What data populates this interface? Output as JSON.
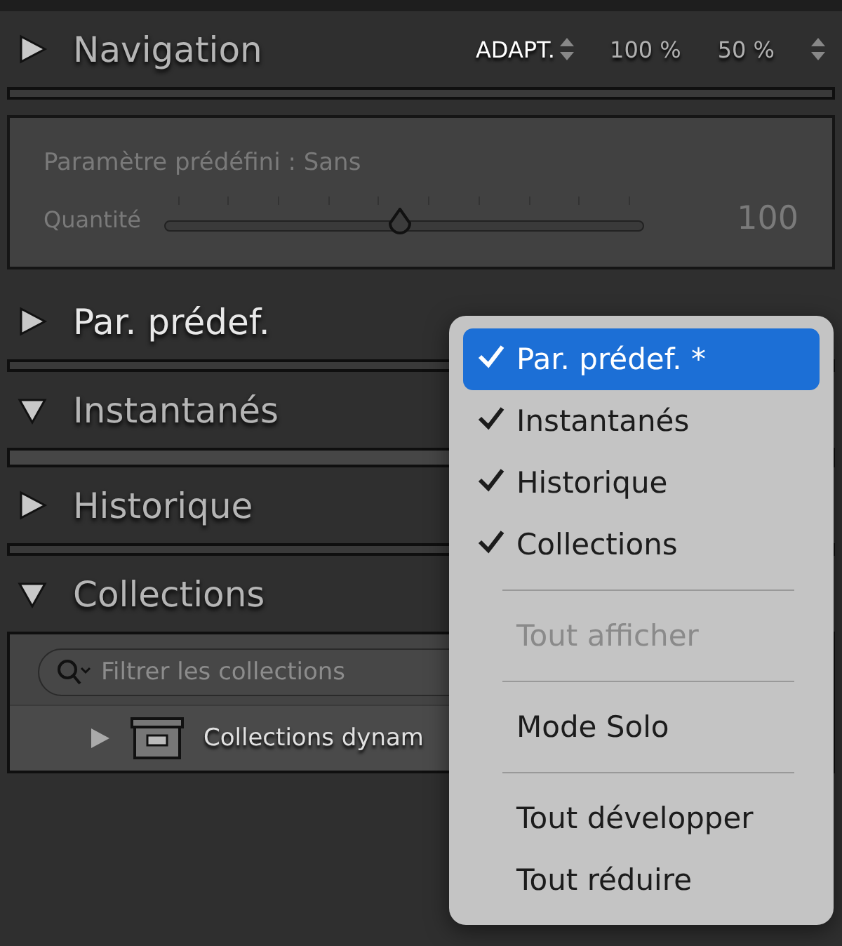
{
  "navigation": {
    "title": "Navigation",
    "expanded": false,
    "zoom_options": [
      {
        "label": "ADAPT.",
        "selected": true
      },
      {
        "label": "100 %",
        "selected": false
      },
      {
        "label": "50 %",
        "selected": false
      }
    ]
  },
  "preset_box": {
    "label": "Paramètre prédéfini : Sans",
    "disabled": true,
    "slider": {
      "label": "Quantité",
      "level": 0.49,
      "reading": "100"
    }
  },
  "sections": [
    {
      "title": "Par. prédef.",
      "expanded": false,
      "selected": true
    },
    {
      "title": "Instantanés",
      "expanded": true,
      "selected": false
    },
    {
      "title": "Historique",
      "expanded": false,
      "selected": false
    },
    {
      "title": "Collections",
      "expanded": true,
      "selected": false,
      "search": {
        "placeholder": "Filtrer les collections"
      },
      "items": [
        {
          "label": "Collections dynam",
          "expanded": false
        }
      ]
    }
  ],
  "context_menu": [
    {
      "kind": "item",
      "label": "Par. prédef. *",
      "checked": true,
      "selected": true,
      "disabled": false
    },
    {
      "kind": "item",
      "label": "Instantanés",
      "checked": true,
      "selected": false,
      "disabled": false
    },
    {
      "kind": "item",
      "label": "Historique",
      "checked": true,
      "selected": false,
      "disabled": false
    },
    {
      "kind": "item",
      "label": "Collections",
      "checked": true,
      "selected": false,
      "disabled": false
    },
    {
      "kind": "separator"
    },
    {
      "kind": "item",
      "label": "Tout afficher",
      "checked": false,
      "selected": false,
      "disabled": true
    },
    {
      "kind": "separator"
    },
    {
      "kind": "item",
      "label": "Mode Solo",
      "checked": false,
      "selected": false,
      "disabled": false
    },
    {
      "kind": "separator"
    },
    {
      "kind": "item",
      "label": "Tout développer",
      "checked": false,
      "selected": false,
      "disabled": false
    },
    {
      "kind": "item",
      "label": "Tout réduire",
      "checked": false,
      "selected": false,
      "disabled": false
    }
  ]
}
